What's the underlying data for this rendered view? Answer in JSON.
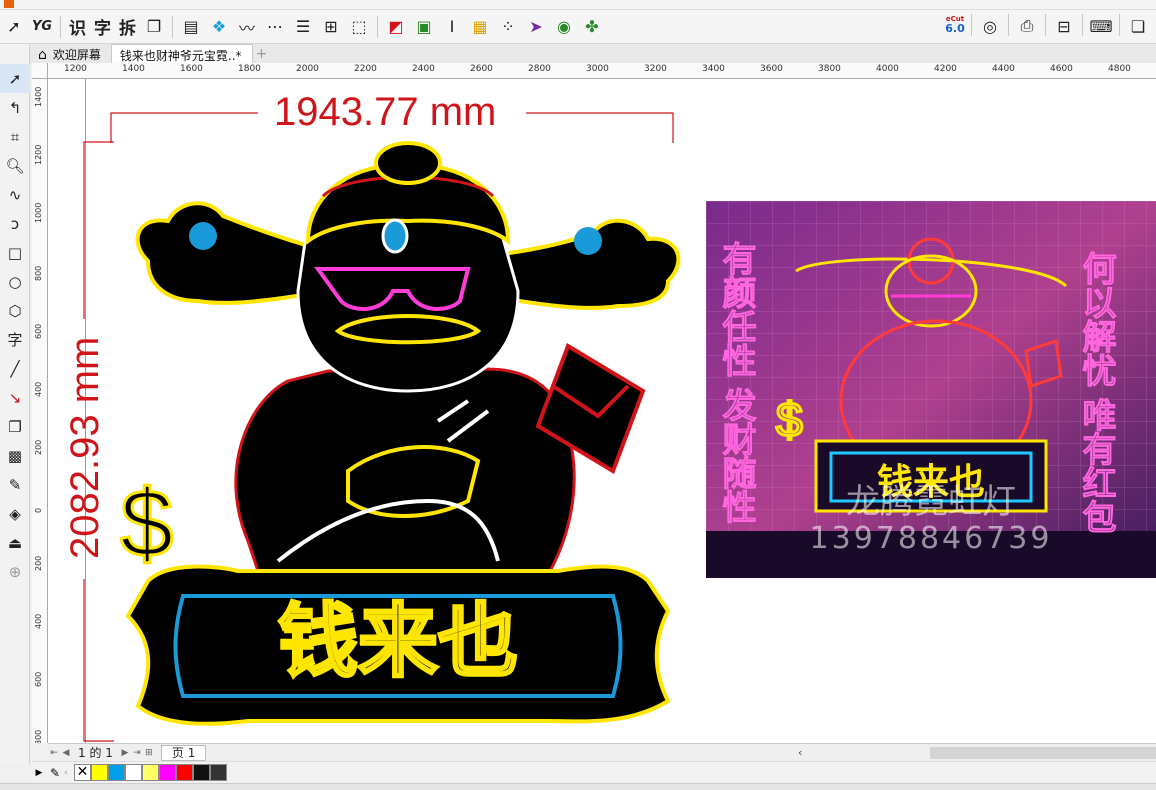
{
  "tabs": [
    {
      "label": "欢迎屏幕",
      "active": false
    },
    {
      "label": "钱来也财神爷元宝霓..*",
      "active": true
    }
  ],
  "ruler_h_labels": [
    "1200",
    "1400",
    "1600",
    "1800",
    "2000",
    "2200",
    "2400",
    "2600",
    "2800",
    "3000",
    "3200",
    "3400",
    "3600",
    "3800",
    "4000",
    "4200",
    "4400",
    "4600",
    "4800"
  ],
  "ruler_v_labels": [
    "1400",
    "1200",
    "1000",
    "800",
    "600",
    "400",
    "200",
    "0",
    "200",
    "400",
    "600",
    "800"
  ],
  "dimensions": {
    "width": "1943.77 mm",
    "height": "2082.93 mm"
  },
  "sign_text": "钱来也",
  "photo": {
    "left_text": "有颜任性 发财随性",
    "right_text": "何以解忧 唯有红包",
    "sign_text": "钱来也",
    "watermark_name": "龙腾霓虹灯",
    "watermark_phone": "13978846739"
  },
  "pagebar": {
    "page_counter": "1 的 1",
    "page_tab": "页 1"
  },
  "toolbar": {
    "text_label_1": "识",
    "text_label_2": "字",
    "text_label_3": "拆",
    "cut_badge": "eCut",
    "cut_version": "6.0"
  },
  "palette": [
    "#ffff00",
    "#00a0e9",
    "#ffffff",
    "#ffff66",
    "#ff00ff",
    "#ff0000",
    "#111111",
    "#333333"
  ],
  "toolbox_text_tool": "字"
}
